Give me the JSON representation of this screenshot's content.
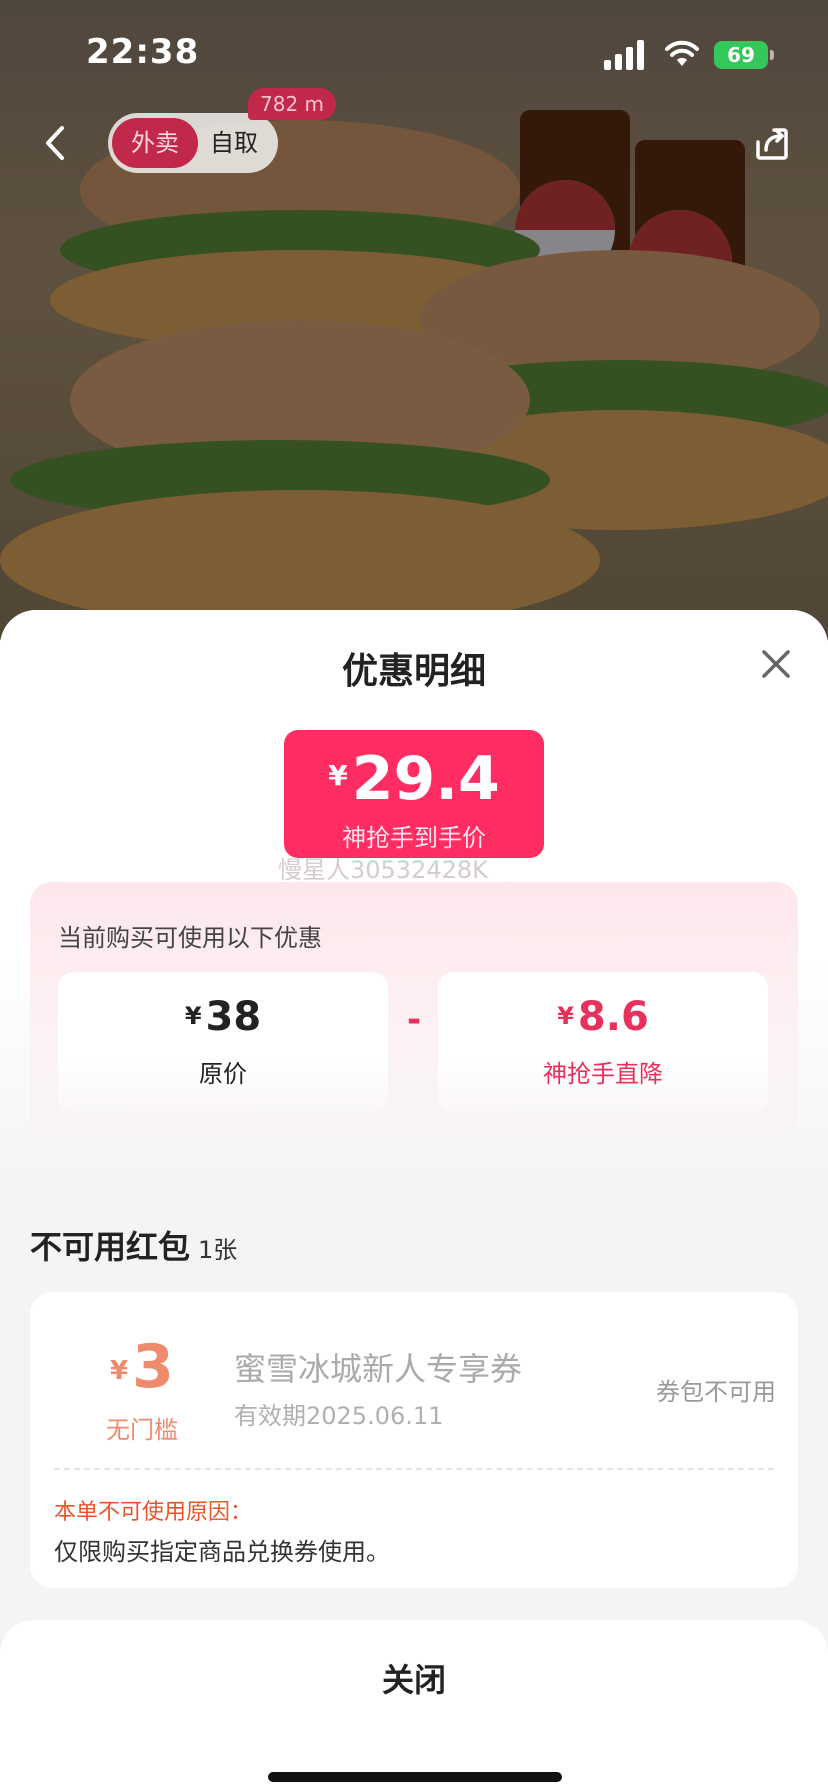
{
  "status_bar": {
    "time": "22:38",
    "battery": "69"
  },
  "nav": {
    "mode_active": "外卖",
    "mode_inactive": "自取",
    "distance": "782 m"
  },
  "sheet": {
    "title": "优惠明细",
    "final_price": {
      "currency": "¥",
      "value": "29.4",
      "caption": "神抢手到手价"
    },
    "watermark": "慢星人30532428K",
    "discount_intro": "当前购买可使用以下优惠",
    "original": {
      "currency": "¥",
      "value": "38",
      "label": "原价"
    },
    "minus": "-",
    "reduction": {
      "currency": "¥",
      "value": "8.6",
      "label": "神抢手直降"
    },
    "unavailable_section": {
      "title": "不可用红包",
      "count": "1张"
    },
    "coupon": {
      "currency": "¥",
      "value": "3",
      "threshold": "无门槛",
      "name": "蜜雪冰城新人专享券",
      "validity": "有效期2025.06.11",
      "status": "券包不可用",
      "reason_title": "本单不可使用原因：",
      "reason_text": "仅限购买指定商品兑换券使用。"
    },
    "close_label": "关闭"
  },
  "colors": {
    "accent": "#ff2d62",
    "mode_active_bg": "#c2284a",
    "coupon_amount": "#f08a6c",
    "reason_title": "#e8552c"
  }
}
